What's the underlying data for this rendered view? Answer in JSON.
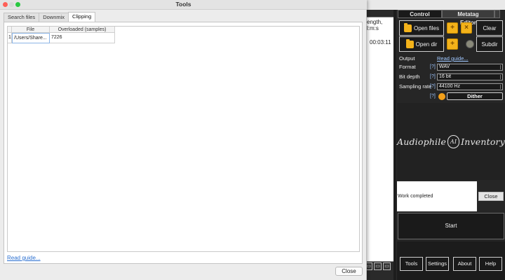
{
  "dialog": {
    "title": "Tools",
    "tabs": [
      "Search files",
      "Downmix",
      "Clipping"
    ],
    "active_tab": "Clipping",
    "table": {
      "columns": [
        "File",
        "Overloaded (samples)"
      ],
      "rows": [
        {
          "index": "1",
          "file": "/Users/Share...",
          "overloaded": "7226"
        }
      ]
    },
    "read_guide": "Read guide...",
    "close": "Close"
  },
  "background_app": {
    "list": {
      "header": "ength, l:m:s",
      "duration": "00:03:11"
    },
    "tabs": [
      "Control",
      "Metatag Editor"
    ],
    "buttons": {
      "open_files": "Open files",
      "clear": "Clear",
      "open_dir": "Open dir",
      "subdir": "Subdir",
      "dither": "Dither",
      "start": "Start",
      "status_close": "Close",
      "tools": "Tools",
      "settings": "Settings",
      "about": "About",
      "help": "Help"
    },
    "output": {
      "label": "Output",
      "read_guide": "Read guide...",
      "format_label": "Format",
      "format_value": "WAV",
      "bitdepth_label": "Bit depth",
      "bitdepth_value": "16 bit",
      "sampling_label": "Sampling rate",
      "sampling_value": "44100 Hz",
      "help_mark": "[?]"
    },
    "logo_text": [
      "Audiophile",
      "AI",
      "Inventory"
    ],
    "status_text": "Work completed"
  }
}
